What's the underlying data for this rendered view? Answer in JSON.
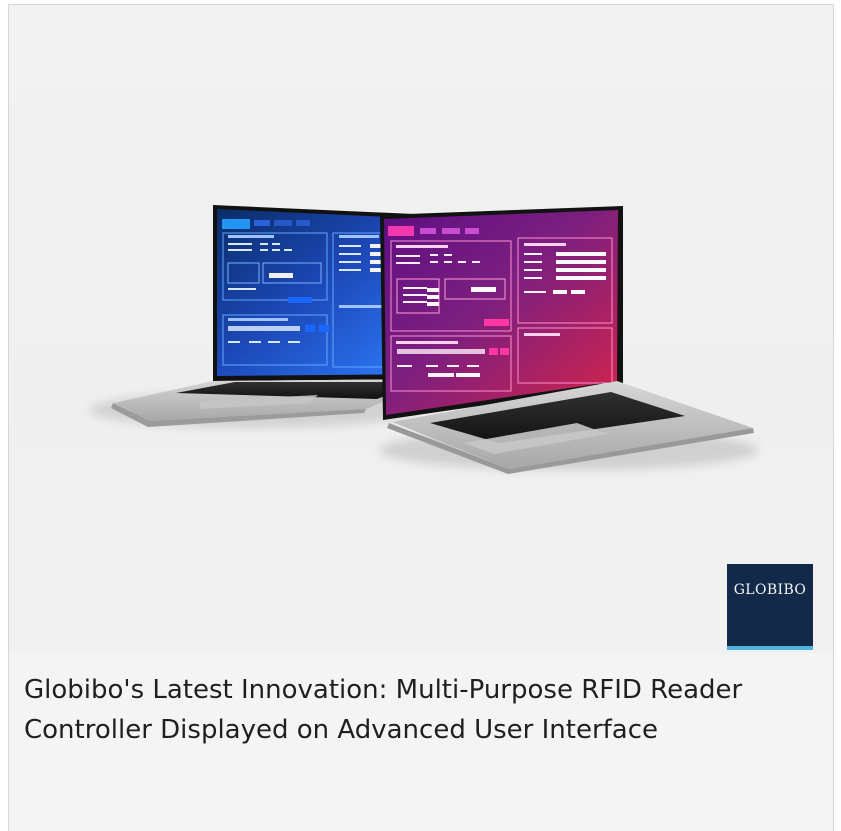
{
  "brand": {
    "logo_text": "GLOBIBO"
  },
  "caption": {
    "text": "Globibo's Latest Innovation: Multi-Purpose RFID Reader Controller Displayed on Advanced User Interface"
  },
  "laptops": {
    "left_screen_accent": "#1e44d8",
    "right_screen_accent": "#c8245f"
  }
}
